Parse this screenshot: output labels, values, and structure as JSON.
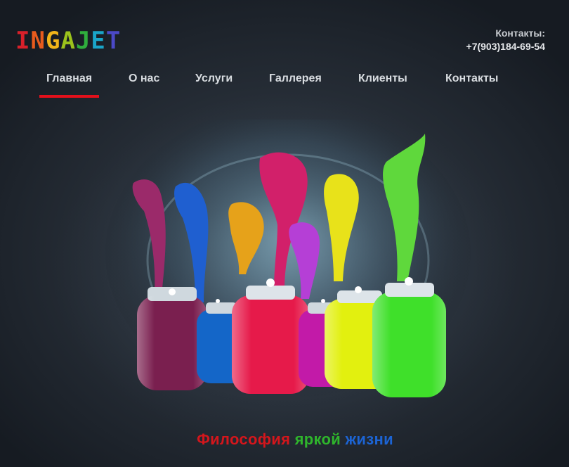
{
  "header": {
    "logo_letters": [
      {
        "char": "I",
        "color": "#d8202a"
      },
      {
        "char": "N",
        "color": "#e85b1d"
      },
      {
        "char": "G",
        "color": "#f2b51a"
      },
      {
        "char": "A",
        "color": "#9cc31c"
      },
      {
        "char": "J",
        "color": "#2fae3d"
      },
      {
        "char": "E",
        "color": "#1aa5c9"
      },
      {
        "char": "T",
        "color": "#4b49c7"
      }
    ],
    "contacts_label": "Контакты:",
    "phone": "+7(903)184-69-54"
  },
  "nav": {
    "items": [
      {
        "label": "Главная",
        "active": true
      },
      {
        "label": "О нас",
        "active": false
      },
      {
        "label": "Услуги",
        "active": false
      },
      {
        "label": "Галлерея",
        "active": false
      },
      {
        "label": "Клиенты",
        "active": false
      },
      {
        "label": "Контакты",
        "active": false
      }
    ],
    "active_color": "#e3101b"
  },
  "hero": {
    "image": "paint-jars-dancers"
  },
  "tagline": {
    "word1": "Философия",
    "word2": "яркой",
    "word3": "жизни"
  }
}
